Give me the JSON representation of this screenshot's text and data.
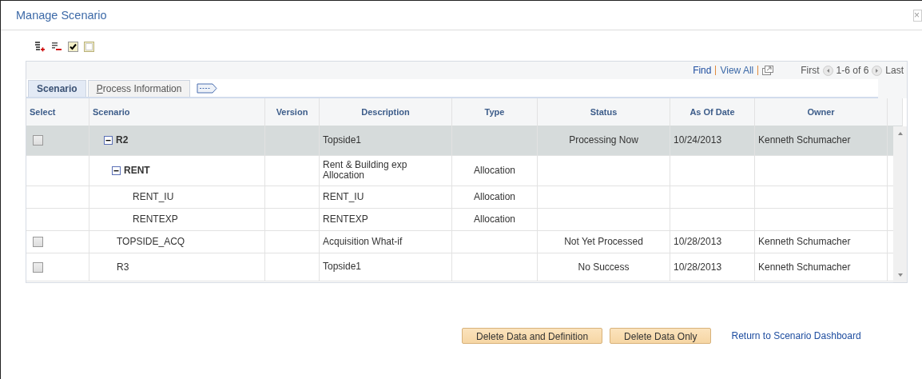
{
  "window": {
    "title": "Manage Scenario",
    "close": "×"
  },
  "grid": {
    "nav": {
      "find": "Find",
      "view_all": "View All",
      "first": "First",
      "range": "1-6 of 6",
      "last": "Last"
    },
    "tabs": [
      {
        "label": "Scenario",
        "selected": true
      },
      {
        "label": "Process Information",
        "selected": false
      }
    ],
    "columns": [
      "Select",
      "Scenario",
      "Version",
      "Description",
      "Type",
      "Status",
      "As Of Date",
      "Owner"
    ],
    "rows": [
      {
        "scenario": "R2",
        "expanded": true,
        "checked": false,
        "selected": true,
        "description": "Topside1",
        "status": "Processing Now",
        "as_of_date": "10/24/2013",
        "owner": "Kenneth Schumacher",
        "children": [
          {
            "scenario": "RENT",
            "expanded": true,
            "selected": false,
            "description": "Rent & Building exp Allocation",
            "type": "Allocation",
            "children": [
              {
                "scenario": "RENT_IU",
                "selected": false,
                "description": "RENT_IU",
                "type": "Allocation"
              },
              {
                "scenario": "RENTEXP",
                "selected": false,
                "description": "RENTEXP",
                "type": "Allocation"
              }
            ]
          }
        ]
      },
      {
        "scenario": "TOPSIDE_ACQ",
        "checked": false,
        "selected": false,
        "description": "Acquisition What-if",
        "status": "Not Yet Processed",
        "as_of_date": "10/28/2013",
        "owner": "Kenneth Schumacher"
      },
      {
        "scenario": "R3",
        "checked": false,
        "selected": false,
        "description": "Topside1",
        "status": "No Success",
        "as_of_date": "10/28/2013",
        "owner": "Kenneth Schumacher"
      }
    ]
  },
  "buttons": [
    "Delete Data and Definition",
    "Delete Data Only"
  ],
  "link": "Return to Scenario Dashboard"
}
